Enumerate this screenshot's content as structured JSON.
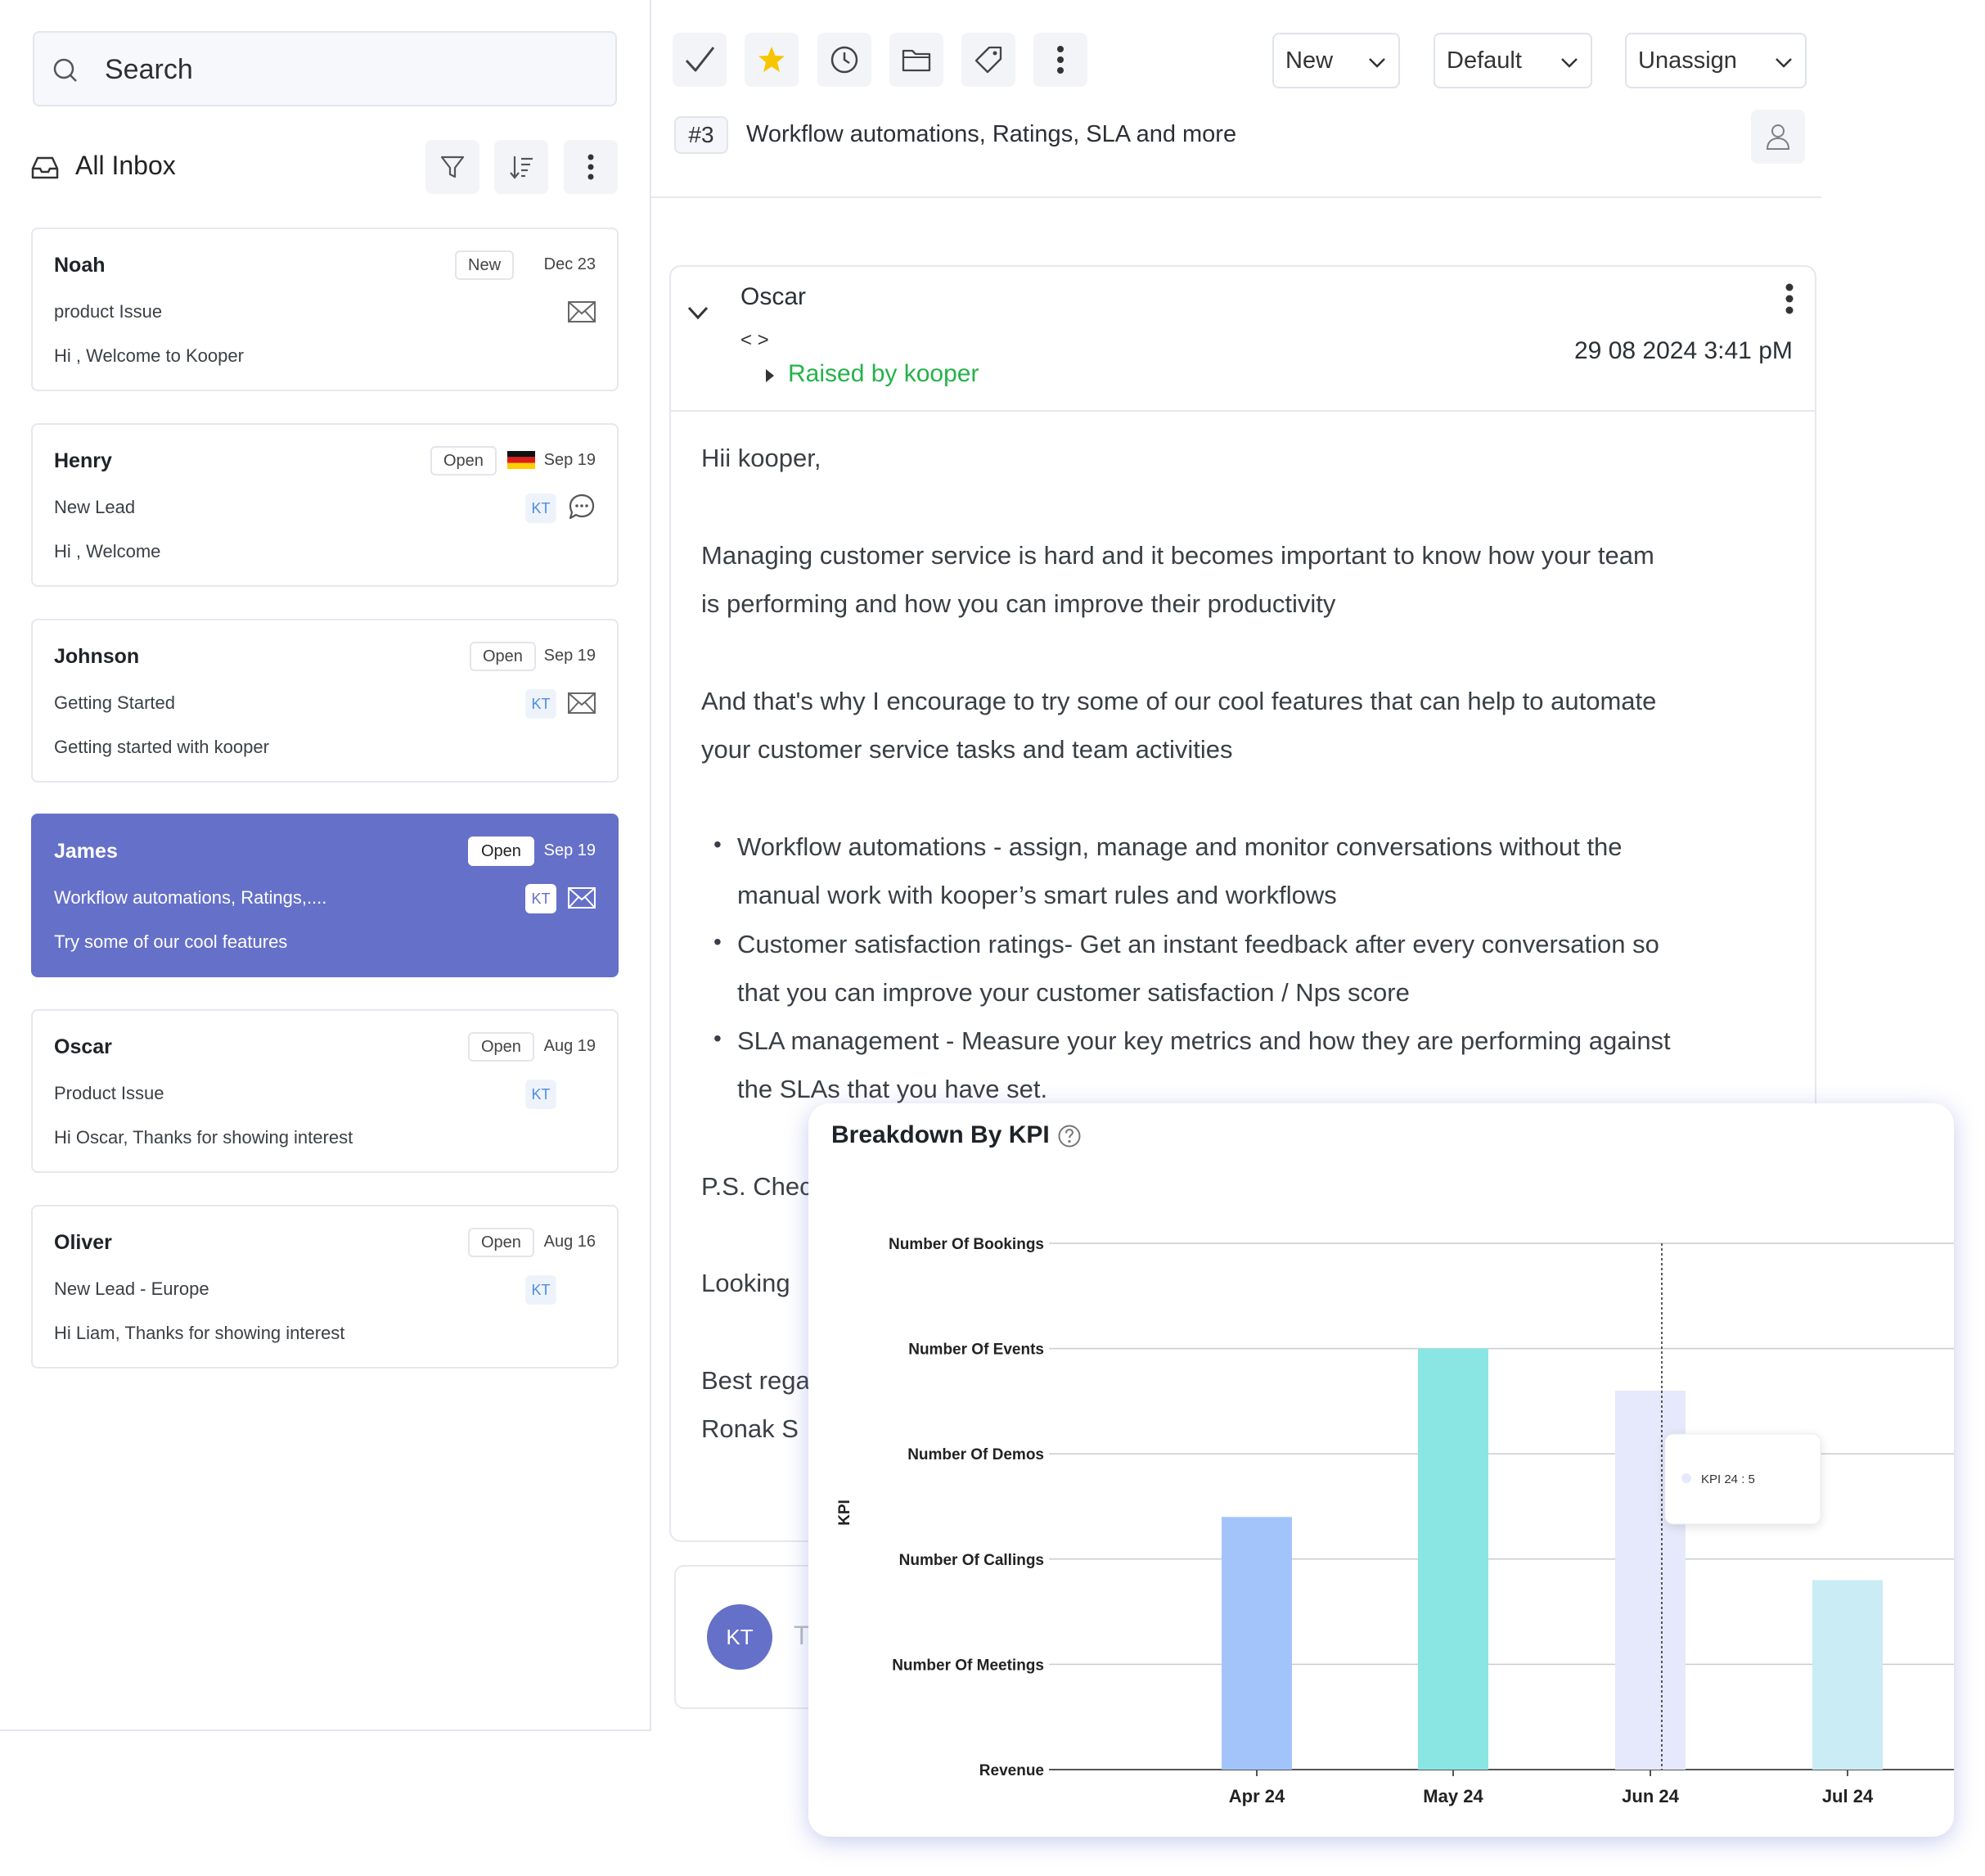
{
  "sidebar": {
    "search_placeholder": "Search",
    "inbox_title": "All Inbox",
    "conversations": [
      {
        "name": "Noah",
        "status": "New",
        "date": "Dec 23",
        "subject": "product Issue",
        "preview": "Hi , Welcome to Kooper",
        "assignee": "",
        "channel": "email-icon"
      },
      {
        "name": "Henry",
        "status": "Open",
        "date": "Sep 19",
        "subject": "New Lead",
        "preview": "Hi , Welcome",
        "assignee": "KT",
        "channel": "chat-icon"
      },
      {
        "name": "Johnson",
        "status": "Open",
        "date": "Sep 19",
        "subject": "Getting Started",
        "preview": "Getting started with kooper",
        "assignee": "KT",
        "channel": "email-icon"
      },
      {
        "name": "James",
        "status": "Open",
        "date": "Sep 19",
        "subject": "Workflow automations, Ratings,....",
        "preview": "Try some of our cool features",
        "assignee": "KT",
        "channel": "email-icon",
        "selected": true
      },
      {
        "name": "Oscar",
        "status": "Open",
        "date": "Aug 19",
        "subject": "Product Issue",
        "preview": "Hi Oscar, Thanks for showing interest",
        "assignee": "KT",
        "channel": ""
      },
      {
        "name": "Oliver",
        "status": "Open",
        "date": "Aug 16",
        "subject": "New Lead - Europe",
        "preview": "Hi Liam, Thanks for showing interest",
        "assignee": "KT",
        "channel": ""
      }
    ]
  },
  "toolbar": {
    "status_select": "New",
    "priority_select": "Default",
    "assign_select": "Unassign"
  },
  "ticket": {
    "number": "#3",
    "title": "Workflow automations, Ratings, SLA and more"
  },
  "message": {
    "sender": "Oscar",
    "sender_email": "< >",
    "raised_by": "Raised by kooper",
    "timestamp": "29 08 2024 3:41 pM",
    "greeting": "Hii kooper,",
    "para1_line1": "Managing customer service is hard and it becomes important to know how your team",
    "para1_line2": "is performing and how you can improve their productivity",
    "para2_line1": "And that's why I encourage to try some of our cool features that can help to automate",
    "para2_line2": "your customer service tasks and team activities",
    "bullets": [
      {
        "line1": "Workflow automations - assign, manage and monitor conversations without the",
        "line2": "manual work with kooper’s smart rules and workflows"
      },
      {
        "line1": "Customer satisfaction ratings- Get an instant feedback after every conversation so",
        "line2": "that you can improve your customer satisfaction / Nps score"
      },
      {
        "line1": "SLA management - Measure your key metrics and how they are performing against",
        "line2": "the SLAs that you have set."
      }
    ],
    "ps_partial": "P.S. Chec",
    "looking_partial": "Looking",
    "regards_partial": "Best rega",
    "signature_partial": "Ronak S"
  },
  "reply": {
    "avatar": "KT",
    "placeholder_partial": "T"
  },
  "colors": {
    "accent": "#6570c9",
    "green": "#25b24a",
    "bar_apr": "#a2c4fb",
    "bar_may": "#8ae6e3",
    "bar_jun": "#e6e9fb",
    "bar_jul": "#c9ecf5"
  },
  "chart_data": {
    "type": "bar",
    "title": "Breakdown By KPI",
    "ylabel": "KPI",
    "xlabel": "",
    "y_categories": [
      "Revenue",
      "Number Of Meetings",
      "Number Of Callings",
      "Number Of Demos",
      "Number Of Events",
      "Number Of Bookings"
    ],
    "categories": [
      "Apr 24",
      "May 24",
      "Jun 24",
      "Jul 24"
    ],
    "values": [
      2.4,
      4.0,
      3.6,
      1.8
    ],
    "ylim": [
      0,
      5
    ],
    "grid": true,
    "tooltip": {
      "category": "Jun 24",
      "text": "KPI 24 : 5"
    }
  }
}
